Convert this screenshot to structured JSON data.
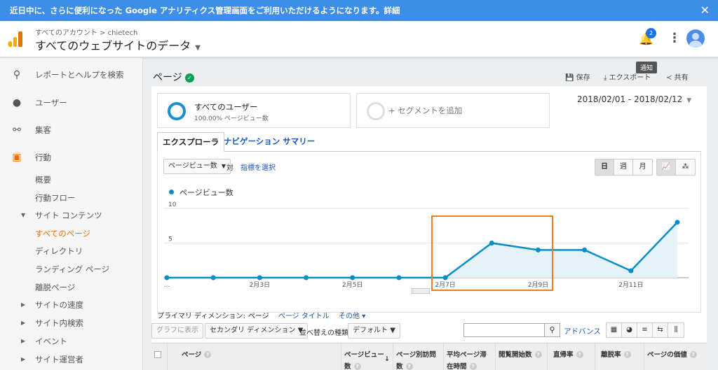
{
  "banner": {
    "text": "近日中に、さらに便利になった Google アナリティクス管理画面をご利用いただけるようになります。詳細",
    "close": "✕"
  },
  "header": {
    "breadcrumb": "すべてのアカウント > chietech",
    "view": "すべてのウェブサイトのデータ",
    "notifications": "2",
    "tooltip": "通知"
  },
  "sidebar": {
    "search": "レポートとヘルプを検索",
    "users": "ユーザー",
    "acquisition": "集客",
    "behavior": "行動",
    "sub": [
      "概要",
      "行動フロー",
      "サイト コンテンツ",
      "すべてのページ",
      "ディレクトリ",
      "ランディング ページ",
      "離脱ページ",
      "サイトの速度",
      "サイト内検索",
      "イベント",
      "サイト運営者"
    ]
  },
  "main": {
    "title": "ページ",
    "actions": {
      "save": "保存",
      "export": "エクスポート",
      "share": "共有"
    },
    "segments": {
      "a_title": "すべてのユーザー",
      "a_sub": "100.00% ページビュー数",
      "b_title": "+ セグメントを追加"
    },
    "daterange": "2018/02/01 - 2018/02/12",
    "tabs": [
      "エクスプローラ",
      "ナビゲーション サマリー"
    ],
    "metric": "ページビュー数",
    "vs": "対",
    "pick_metric": "指標を選択",
    "gran": [
      "日",
      "週",
      "月"
    ],
    "legend": "ページビュー数",
    "primary_dim_label": "プライマリ ディメンション:",
    "primary_dim": "ページ",
    "dim_opt1": "ページ タイトル",
    "dim_opt2": "その他 ▾",
    "btn_graph": "グラフに表示",
    "btn_secondary": "セカンダリ ディメンション",
    "sort_label": "並べ替えの種類:",
    "sort_value": "デフォルト",
    "advanced": "アドバンス",
    "columns": [
      "ページ",
      "ページビュー数",
      "ページ別訪問数",
      "平均ページ滞在時間",
      "閲覧開始数",
      "直帰率",
      "離脱率",
      "ページの価値"
    ]
  },
  "chart_data": {
    "type": "area",
    "x": [
      "2018/02/01",
      "2018/02/02",
      "2018/02/03",
      "2018/02/04",
      "2018/02/05",
      "2018/02/06",
      "2018/02/07",
      "2018/02/08",
      "2018/02/09",
      "2018/02/10",
      "2018/02/11",
      "2018/02/12"
    ],
    "x_tick_labels": [
      "…",
      "2月3日",
      "2月5日",
      "2月7日",
      "2月9日",
      "2月11日"
    ],
    "series": [
      {
        "name": "ページビュー数",
        "values": [
          0,
          0,
          0,
          0,
          0,
          0,
          0,
          5,
          4,
          4,
          1,
          8
        ]
      }
    ],
    "ylim": [
      0,
      10
    ],
    "yticks": [
      5,
      10
    ],
    "color": "#058dc7"
  }
}
